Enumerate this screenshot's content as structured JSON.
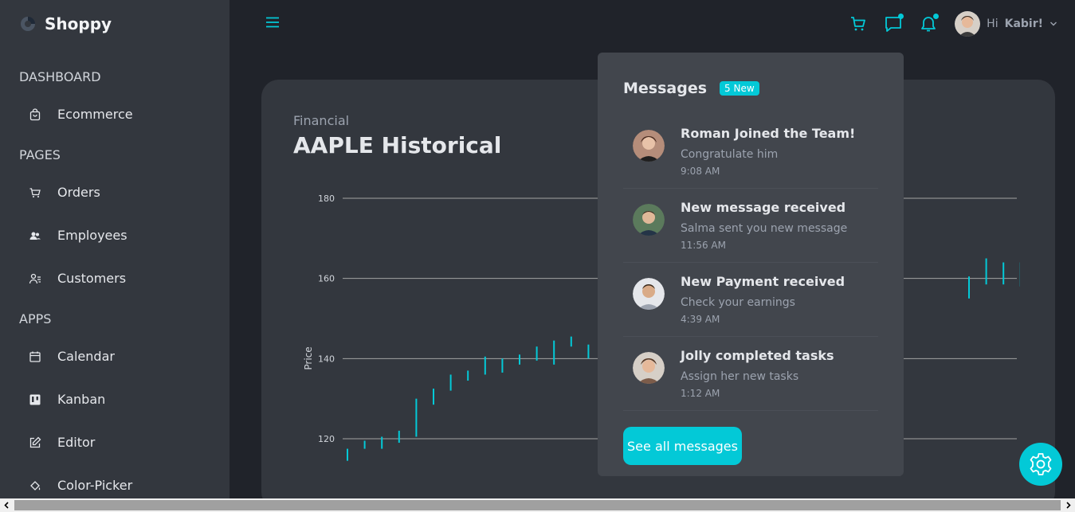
{
  "brand": {
    "name": "Shoppy"
  },
  "sidebar": {
    "sections": [
      {
        "title": "DASHBOARD",
        "items": [
          {
            "label": "Ecommerce",
            "icon": "shopping-bag-icon"
          }
        ]
      },
      {
        "title": "PAGES",
        "items": [
          {
            "label": "Orders",
            "icon": "cart-icon"
          },
          {
            "label": "Employees",
            "icon": "people-icon"
          },
          {
            "label": "Customers",
            "icon": "customers-icon"
          }
        ]
      },
      {
        "title": "APPS",
        "items": [
          {
            "label": "Calendar",
            "icon": "calendar-icon"
          },
          {
            "label": "Kanban",
            "icon": "kanban-icon"
          },
          {
            "label": "Editor",
            "icon": "edit-icon"
          },
          {
            "label": "Color-Picker",
            "icon": "paint-bucket-icon"
          }
        ]
      }
    ]
  },
  "topbar": {
    "greeting": "Hi",
    "user_name": "Kabir!",
    "accent": "#03c9d7"
  },
  "card": {
    "subtitle": "Financial",
    "title": "AAPLE Historical"
  },
  "chart_data": {
    "type": "candlestick",
    "ylabel": "Price",
    "ylim": [
      115,
      180
    ],
    "yticks": [
      120,
      140,
      160,
      180
    ],
    "grid": true,
    "series": [
      {
        "values": [
          {
            "low": 114.5,
            "high": 117.5
          },
          {
            "low": 117.5,
            "high": 119.5
          },
          {
            "low": 117.5,
            "high": 120.5
          },
          {
            "low": 119.0,
            "high": 122.0
          },
          {
            "low": 120.5,
            "high": 130.0
          },
          {
            "low": 128.5,
            "high": 132.5
          },
          {
            "low": 132.0,
            "high": 136.0
          },
          {
            "low": 134.5,
            "high": 137.0
          },
          {
            "low": 136.0,
            "high": 140.5
          },
          {
            "low": 136.5,
            "high": 140.0
          },
          {
            "low": 138.5,
            "high": 141.0
          },
          {
            "low": 139.5,
            "high": 143.0
          },
          {
            "low": 138.5,
            "high": 144.5
          },
          {
            "low": 143.0,
            "high": 145.5
          },
          {
            "low": 140.0,
            "high": 143.5
          },
          {
            "low": 155.0,
            "high": 160.5
          },
          {
            "low": 158.5,
            "high": 165.0
          },
          {
            "low": 158.5,
            "high": 164.0
          },
          {
            "low": 158.0,
            "high": 164.0
          },
          {
            "low": 158.0,
            "high": 160.5
          }
        ]
      }
    ]
  },
  "messages": {
    "title": "Messages",
    "badge": "5 New",
    "items": [
      {
        "title": "Roman Joined the Team!",
        "desc": "Congratulate him",
        "time": "9:08 AM",
        "avatar_color": "#b58d7a"
      },
      {
        "title": "New message received",
        "desc": "Salma sent you new message",
        "time": "11:56 AM",
        "avatar_color": "#5b7a5c"
      },
      {
        "title": "New Payment received",
        "desc": "Check your earnings",
        "time": "4:39 AM",
        "avatar_color": "#c9b29a"
      },
      {
        "title": "Jolly completed tasks",
        "desc": "Assign her new tasks",
        "time": "1:12 AM",
        "avatar_color": "#a87a60"
      }
    ],
    "see_all": "See all messages"
  }
}
